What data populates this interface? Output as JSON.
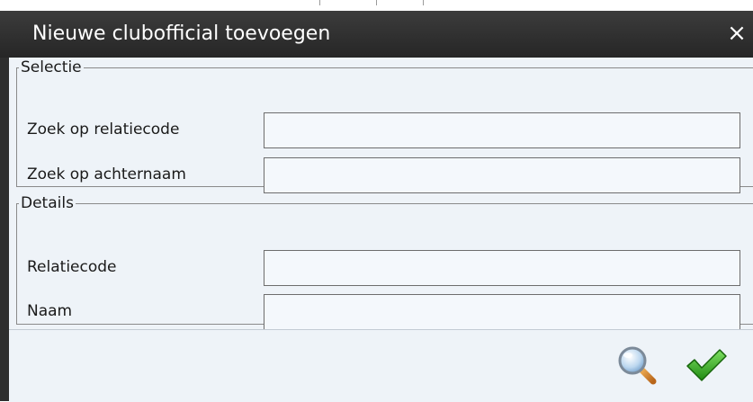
{
  "dialog": {
    "title": "Nieuwe clubofficial toevoegen",
    "close_label": "×"
  },
  "selectie": {
    "legend": "Selectie",
    "fields": [
      {
        "label": "Zoek op relatiecode",
        "value": ""
      },
      {
        "label": "Zoek op achternaam",
        "value": ""
      }
    ]
  },
  "details": {
    "legend": "Details",
    "fields": [
      {
        "label": "Relatiecode",
        "value": ""
      },
      {
        "label": "Naam",
        "value": ""
      }
    ]
  },
  "footer": {
    "search_icon": "magnifier-icon",
    "confirm_icon": "checkmark-icon"
  },
  "colors": {
    "titlebar": "#2e2e2e",
    "body": "#eef3f8",
    "confirm": "#2e9e1e"
  }
}
